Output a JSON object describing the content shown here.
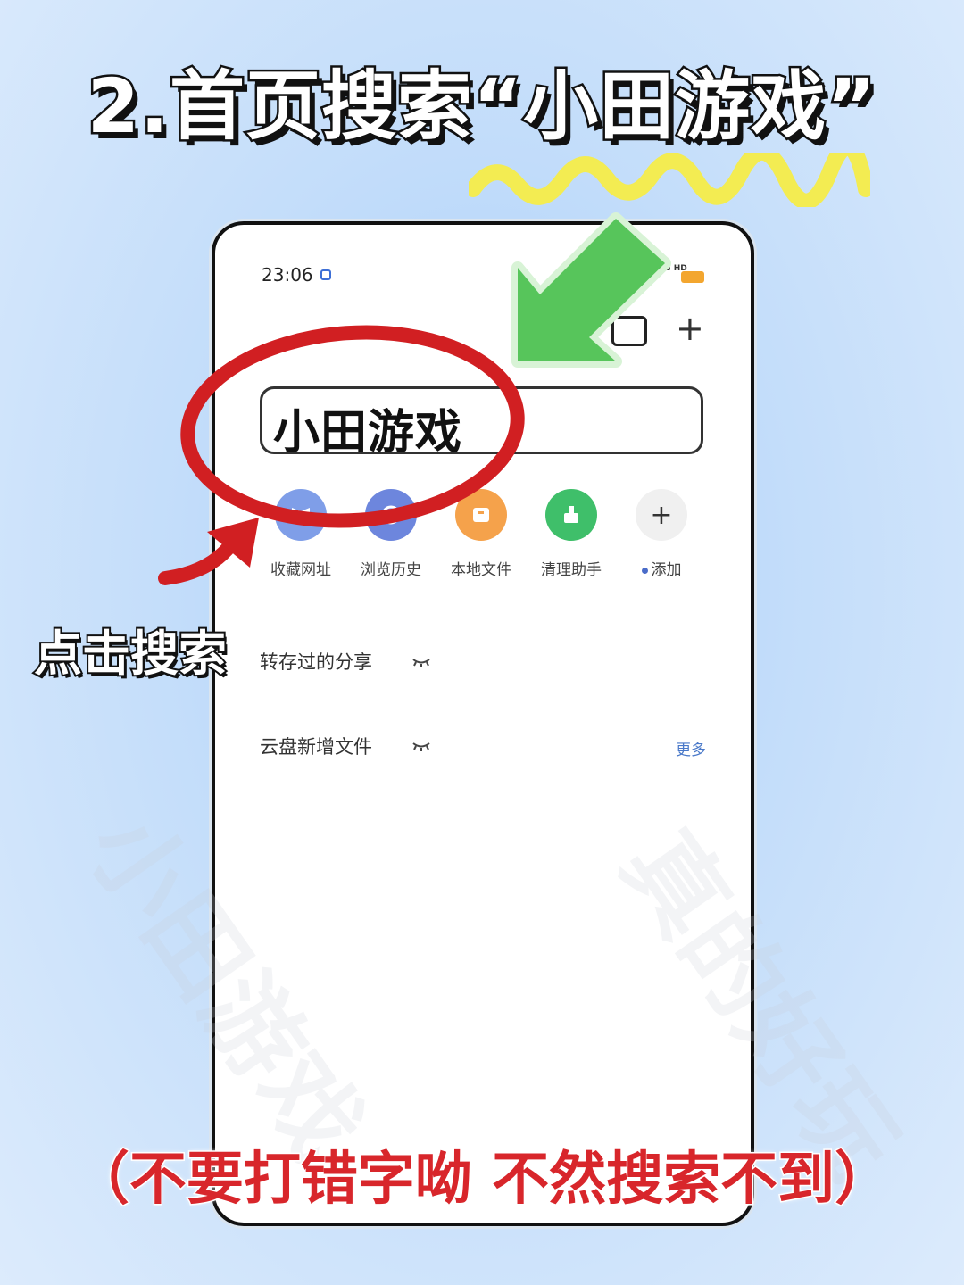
{
  "headline": "2.首页搜索“小田游戏”",
  "phone": {
    "status_time": "23:06",
    "status_network": "5G HD  5G HD",
    "search_value": "小田游戏",
    "quick_items": [
      {
        "label": "收藏网址",
        "icon": "bookmark-icon",
        "color": "#7f9ee8"
      },
      {
        "label": "浏览历史",
        "icon": "history-icon",
        "color": "#6d86dd"
      },
      {
        "label": "本地文件",
        "icon": "folder-icon",
        "color": "#f5a24b"
      },
      {
        "label": "清理助手",
        "icon": "broom-icon",
        "color": "#3fbf6a"
      },
      {
        "label": "添加",
        "icon": "plus-icon",
        "color": "#f0f0f0"
      }
    ],
    "section_saved": "转存过的分享",
    "section_cloud": "云盘新增文件",
    "more_label": "更多"
  },
  "annotations": {
    "click_label": "点击搜索",
    "warning": "（不要打错字呦  不然搜索不到）",
    "circle_color": "#d11f22",
    "arrow_color": "#4fc45a",
    "squiggle_color": "#f3ec52"
  },
  "watermarks": [
    "小田游戏",
    "真的好玩"
  ]
}
